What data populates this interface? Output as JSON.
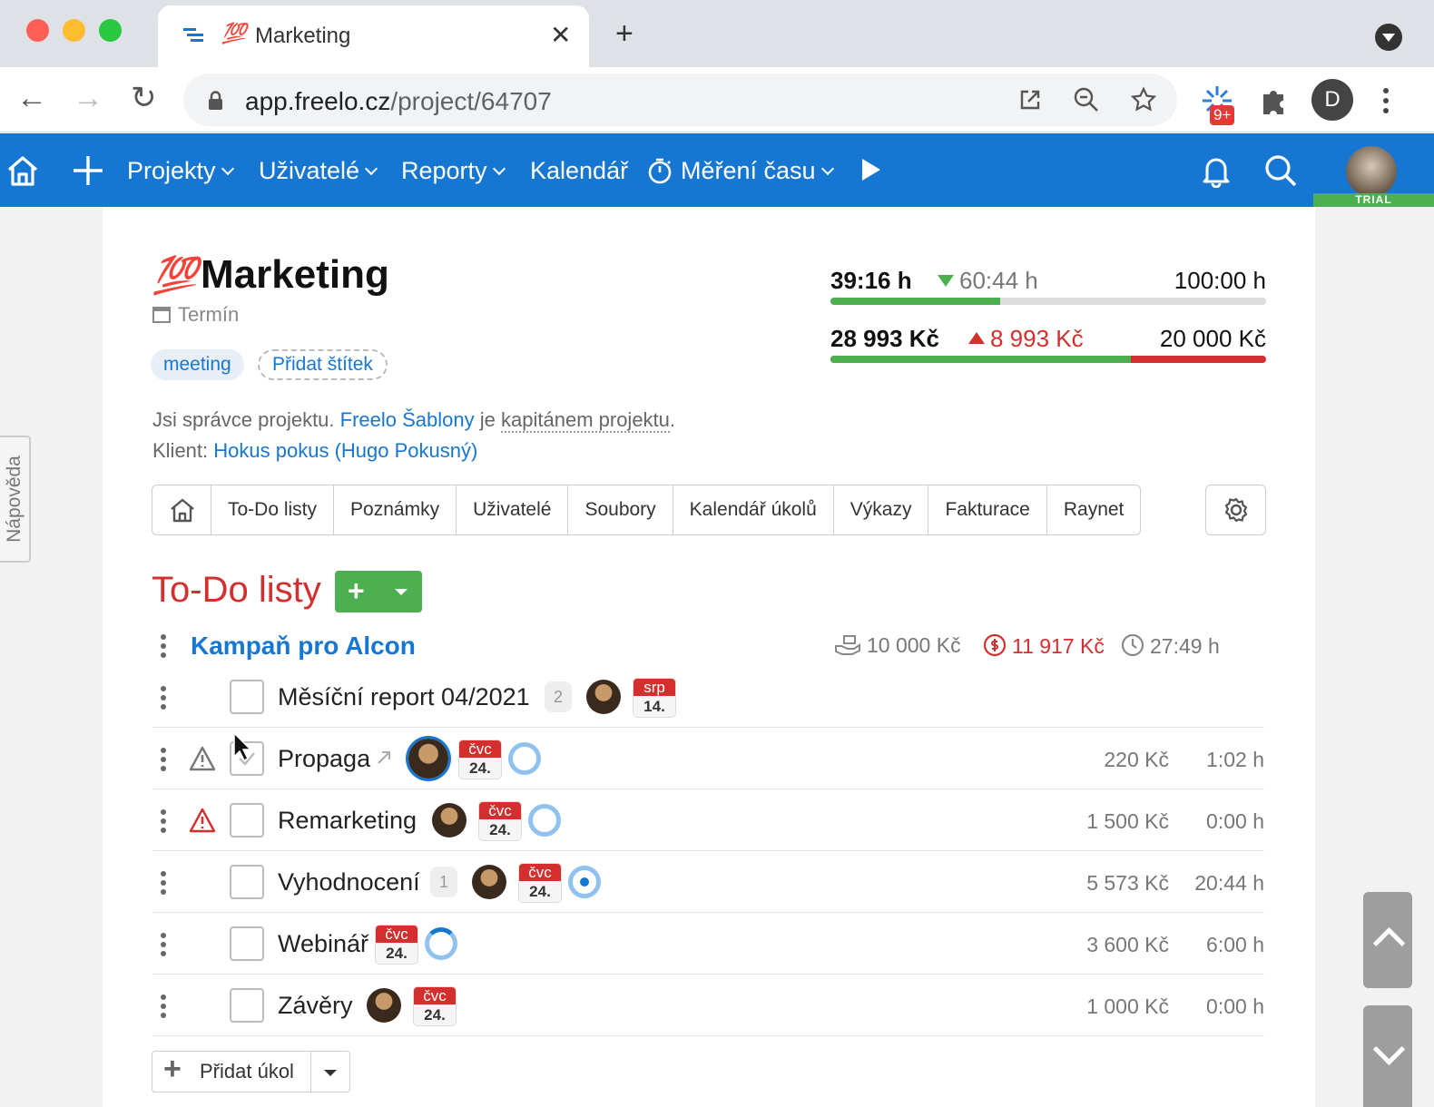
{
  "browser": {
    "tab_title": "Marketing",
    "tab_emoji": "💯",
    "url_host": "app.freelo.cz",
    "url_path": "/project/64707",
    "ext_badge": "9+",
    "profile_initial": "D"
  },
  "appbar": {
    "nav": [
      "Projekty",
      "Uživatelé",
      "Reporty",
      "Kalendář",
      "Měření času"
    ],
    "trial_label": "TRIAL"
  },
  "help_tab": "Nápověda",
  "project": {
    "emoji": "💯",
    "title": "Marketing",
    "deadline_label": "Termín",
    "tags": [
      "meeting"
    ],
    "add_tag_label": "Přidat štítek",
    "admin_text": "Jsi správce projektu.",
    "owner_link": "Freelo Šablony",
    "owner_mid": "je",
    "captain_link": "kapitánem projektu",
    "client_label": "Klient:",
    "client_link": "Hokus pokus (Hugo Pokusný)"
  },
  "stats": {
    "time_spent": "39:16 h",
    "time_remaining": "60:44 h",
    "time_budget": "100:00 h",
    "time_progress": 0.39,
    "money_spent": "28 993 Kč",
    "money_over": "8 993 Kč",
    "money_budget": "20 000 Kč",
    "money_progress_green": 0.69,
    "colors": {
      "green": "#4caf50",
      "red": "#d32f2f"
    }
  },
  "project_tabs": [
    "To-Do listy",
    "Poznámky",
    "Uživatelé",
    "Soubory",
    "Kalendář úkolů",
    "Výkazy",
    "Fakturace",
    "Raynet"
  ],
  "todo": {
    "heading": "To-Do listy",
    "list_title": "Kampaň pro Alcon",
    "list_budget": "10 000 Kč",
    "list_cost": "11 917 Kč",
    "list_time": "27:49 h",
    "tasks": [
      {
        "name": "Měsíční report 04/2021",
        "count": "2",
        "date_month": "srp",
        "date_day": "14.",
        "price": "",
        "hours": ""
      },
      {
        "name": "Propaga",
        "date_month": "čvc",
        "date_day": "24.",
        "price": "220 Kč",
        "hours": "1:02 h"
      },
      {
        "name": "Remarketing",
        "date_month": "čvc",
        "date_day": "24.",
        "price": "1 500 Kč",
        "hours": "0:00 h"
      },
      {
        "name": "Vyhodnocení",
        "count": "1",
        "date_month": "čvc",
        "date_day": "24.",
        "price": "5 573 Kč",
        "hours": "20:44 h"
      },
      {
        "name": "Webinář",
        "date_month": "čvc",
        "date_day": "24.",
        "price": "3 600 Kč",
        "hours": "6:00 h"
      },
      {
        "name": "Závěry",
        "date_month": "čvc",
        "date_day": "24.",
        "price": "1 000 Kč",
        "hours": "0:00 h"
      }
    ],
    "add_task_label": "Přidat úkol"
  }
}
